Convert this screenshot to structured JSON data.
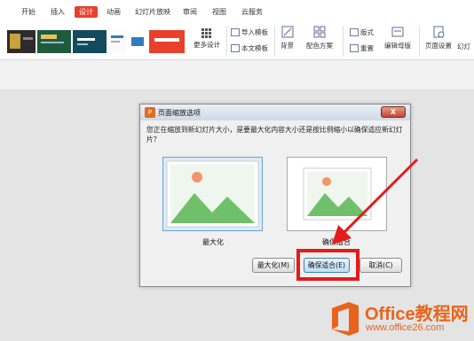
{
  "ribbon": {
    "tabs": [
      "开始",
      "插入",
      "设计",
      "动画",
      "幻灯片放映",
      "审阅",
      "视图",
      "云服务"
    ],
    "active_tab": "设计",
    "more_design": "更多设计",
    "import_template": "导入模板",
    "text_template": "本文模板",
    "background": "背景",
    "color_scheme": "配色方案",
    "layout": "版式",
    "reset": "重置",
    "edit_master": "编辑母版",
    "page_setup": "页面设置",
    "slide_size": "幻灯"
  },
  "dialog": {
    "title": "页面缩放选项",
    "close": "X",
    "question": "您正在缩放到新幻灯片大小，是要最大化内容大小还是按比例缩小以确保适应新幻灯片？",
    "option_maximize": "最大化",
    "option_fit": "确保适合",
    "btn_maximize": "最大化(M)",
    "btn_fit": "确保适合(E)",
    "btn_cancel": "取消(C)"
  },
  "watermark": {
    "brand": "Office教程网",
    "url": "www.office26.com"
  },
  "colors": {
    "accent": "#e8402b",
    "highlight": "#e41b1b",
    "watermark": "#e8641b",
    "mountain": "#6fbf6b",
    "sun": "#f2956b"
  }
}
